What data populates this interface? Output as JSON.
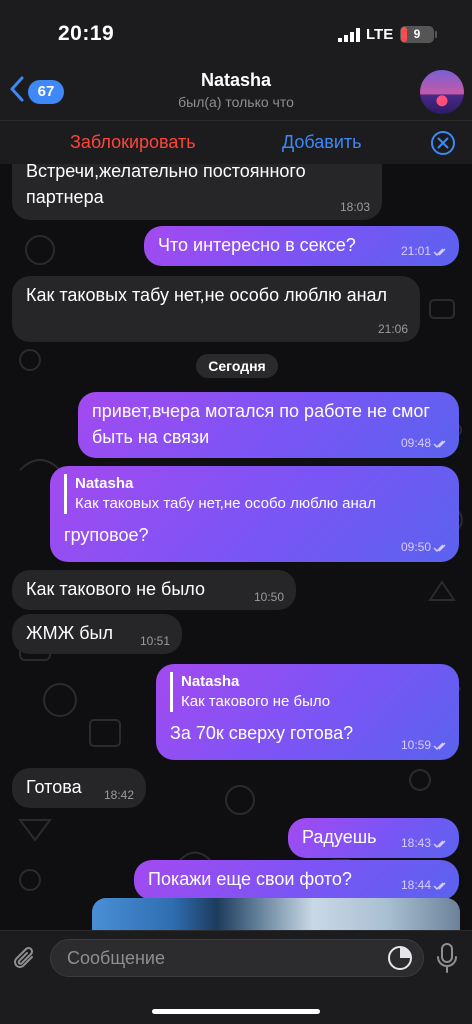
{
  "status_bar": {
    "time": "20:19",
    "network": "LTE",
    "battery_level": "9"
  },
  "header": {
    "back_count": "67",
    "title": "Natasha",
    "subtitle": "был(а) только что"
  },
  "action_bar": {
    "block_label": "Заблокировать",
    "add_label": "Добавить"
  },
  "messages": [
    {
      "dir": "in",
      "text": "Встречи,желательно постоянного партнера",
      "time": "18:03"
    },
    {
      "dir": "out",
      "text": "Что интересно в сексе?",
      "time": "21:01"
    },
    {
      "dir": "in",
      "text": "Как таковых табу нет,не особо люблю анал",
      "time": "21:06"
    },
    {
      "dir": "out",
      "text": "привет,вчера мотался по работе не смог быть на связи",
      "time": "09:48"
    },
    {
      "dir": "out",
      "reply_name": "Natasha",
      "reply_text": "Как таковых табу нет,не особо люблю анал",
      "text": "груповое?",
      "time": "09:50"
    },
    {
      "dir": "in",
      "text": "Как такового не было",
      "time": "10:50"
    },
    {
      "dir": "in",
      "text": "ЖМЖ был",
      "time": "10:51"
    },
    {
      "dir": "out",
      "reply_name": "Natasha",
      "reply_text": "Как такового не было",
      "text": "За 70к сверху готова?",
      "time": "10:59"
    },
    {
      "dir": "in",
      "text": "Готова",
      "time": "18:42"
    },
    {
      "dir": "out",
      "text": "Радуешь",
      "time": "18:43"
    },
    {
      "dir": "out",
      "text": "Покажи еще свои фото?",
      "time": "18:44"
    }
  ],
  "date_separator": "Сегодня",
  "input": {
    "placeholder": "Сообщение"
  },
  "icons": [
    "back-chevron-icon",
    "signal-icon",
    "battery-icon",
    "close-icon",
    "read-check-icon",
    "attach-icon",
    "sticker-icon",
    "mic-icon"
  ],
  "colors": {
    "accent": "#3e88f7",
    "danger": "#ff453a",
    "outgoing_start": "#a34af0",
    "outgoing_end": "#5a63ee",
    "incoming": "#262628"
  }
}
